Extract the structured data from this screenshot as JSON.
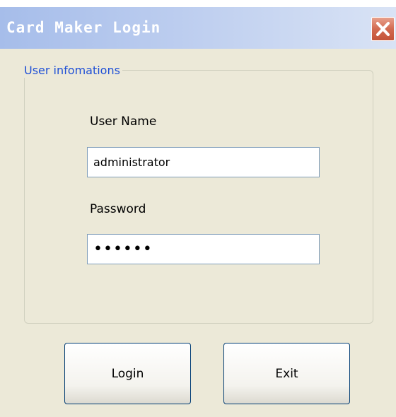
{
  "window": {
    "title": "Card Maker Login"
  },
  "group": {
    "legend": "User infomations"
  },
  "form": {
    "username_label": "User Name",
    "username_value": "administrator",
    "password_label": "Password",
    "password_masked": "••••••"
  },
  "buttons": {
    "login_label": "Login",
    "exit_label": "Exit"
  },
  "icons": {
    "close": "close-icon"
  },
  "colors": {
    "titlebar_start": "#a6bdea",
    "titlebar_end": "#d9e3f5",
    "dialog_background": "#ece9d8",
    "legend_text": "#1e4fd6",
    "close_button": "#d26a50",
    "button_border": "#003c74",
    "input_border": "#7f9db9"
  }
}
